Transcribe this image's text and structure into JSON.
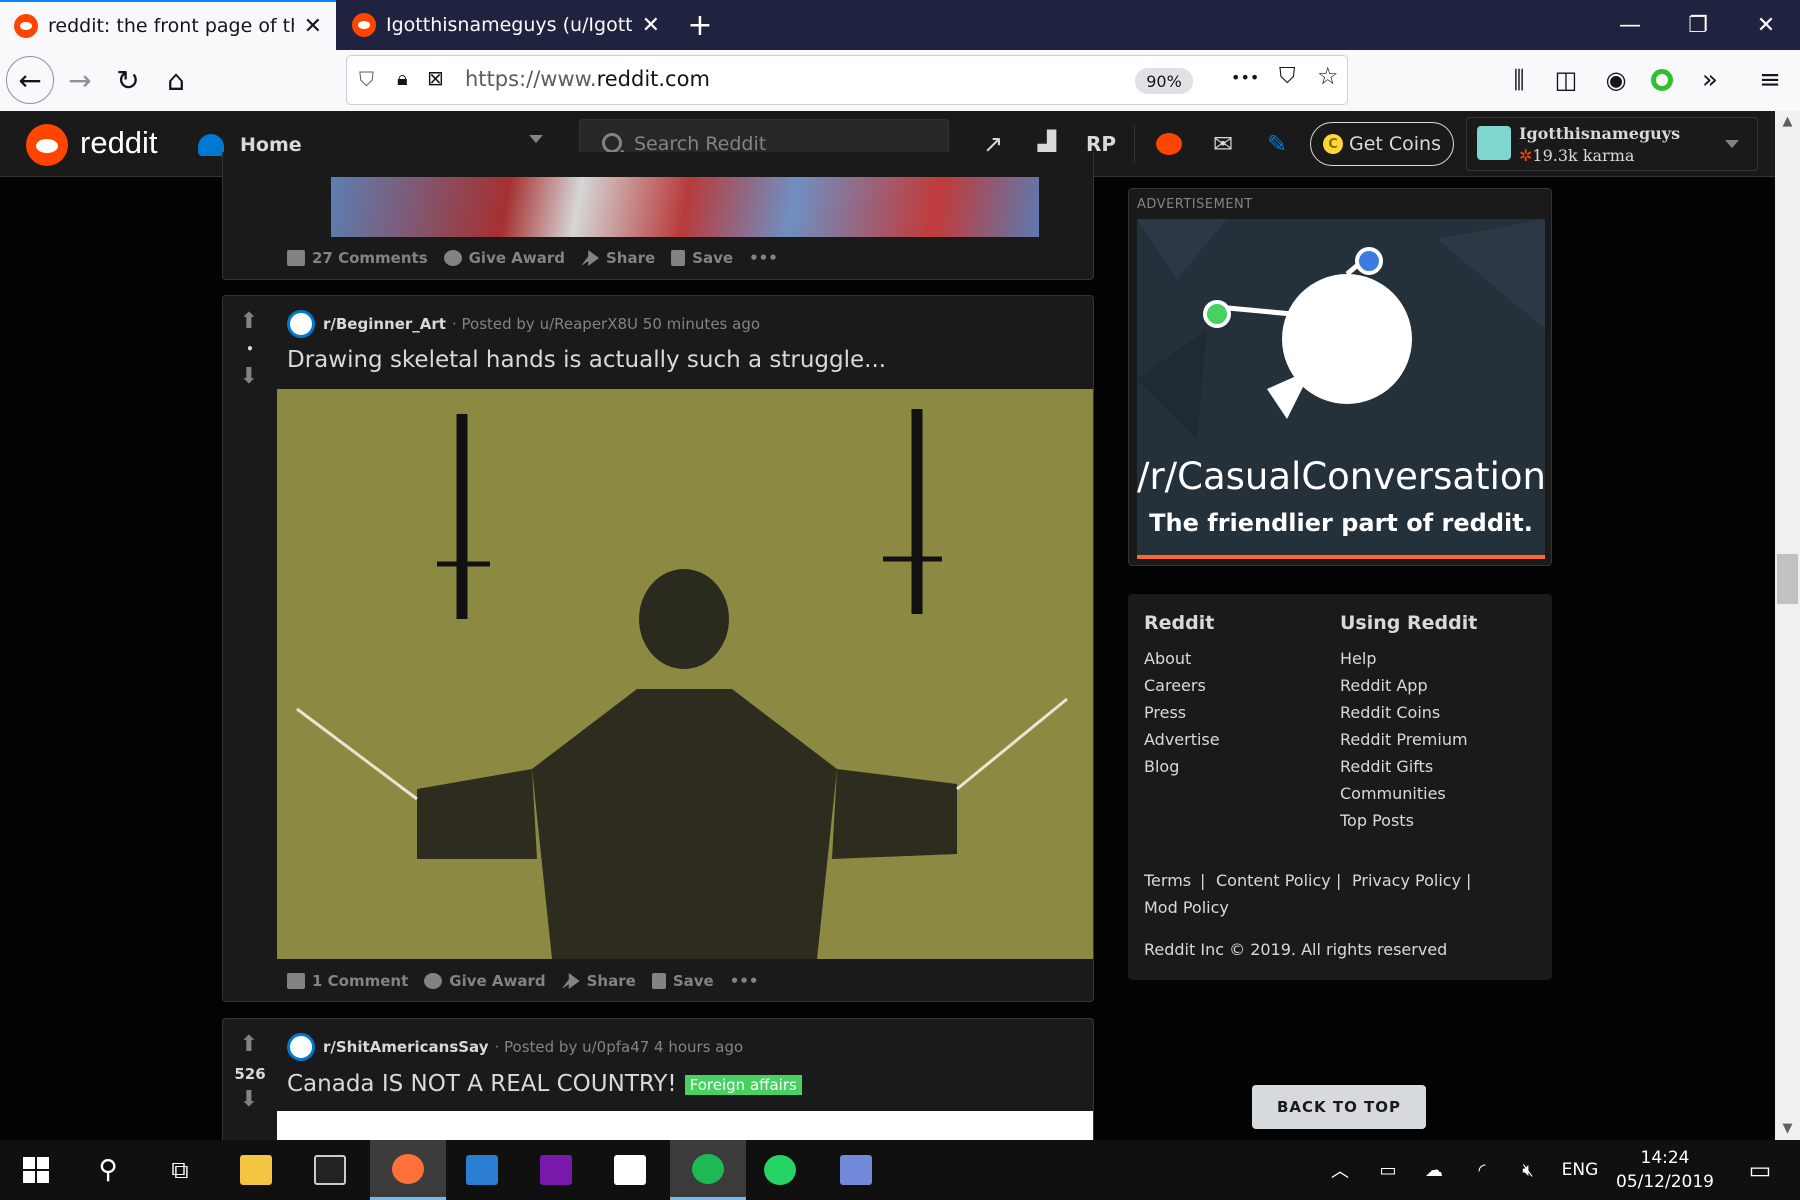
{
  "browser": {
    "tabs": [
      {
        "title": "reddit: the front page of the int",
        "active": true
      },
      {
        "title": "Igotthisnameguys (u/Igotthisna",
        "active": false
      }
    ],
    "url_scheme": "https://www.",
    "url_host": "reddit.com",
    "zoom": "90%",
    "new_tab": "+",
    "more": "•••"
  },
  "header": {
    "logo": "reddit",
    "feed": "Home",
    "search_placeholder": "Search Reddit",
    "get_coins": "Get Coins",
    "username": "Igotthisnameguys",
    "karma": "19.3k karma"
  },
  "posts": [
    {
      "actions": {
        "comments": "27 Comments",
        "award": "Give Award",
        "share": "Share",
        "save": "Save",
        "more": "•••"
      }
    },
    {
      "subreddit": "r/Beginner_Art",
      "posted_by": "· Posted by u/ReaperX8U 50 minutes ago",
      "score": "•",
      "title": "Drawing skeletal hands is actually such a struggle...",
      "actions": {
        "comments": "1 Comment",
        "award": "Give Award",
        "share": "Share",
        "save": "Save",
        "more": "•••"
      }
    },
    {
      "subreddit": "r/ShitAmericansSay",
      "posted_by": "· Posted by u/0pfa47 4 hours ago",
      "score": "526",
      "title": "Canada IS NOT A REAL COUNTRY!",
      "flair": "Foreign affairs"
    }
  ],
  "sidebar": {
    "ad_label": "ADVERTISEMENT",
    "ad_title": "/r/CasualConversation",
    "ad_subtitle": "The friendlier part of reddit.",
    "col1_head": "Reddit",
    "col1": [
      "About",
      "Careers",
      "Press",
      "Advertise",
      "Blog"
    ],
    "col2_head": "Using Reddit",
    "col2": [
      "Help",
      "Reddit App",
      "Reddit Coins",
      "Reddit Premium",
      "Reddit Gifts",
      "Communities",
      "Top Posts"
    ],
    "policies": [
      "Terms",
      "Content Policy",
      "Privacy Policy",
      "Mod Policy"
    ],
    "separator": "|",
    "copyright": "Reddit Inc © 2019. All rights reserved",
    "back_to_top": "BACK TO TOP"
  },
  "taskbar": {
    "lang": "ENG",
    "time": "14:24",
    "date": "05/12/2019"
  },
  "colors": {
    "reddit_orange": "#ff4500",
    "flair_green": "#46d160",
    "firefox_blue": "#0a84ff"
  }
}
